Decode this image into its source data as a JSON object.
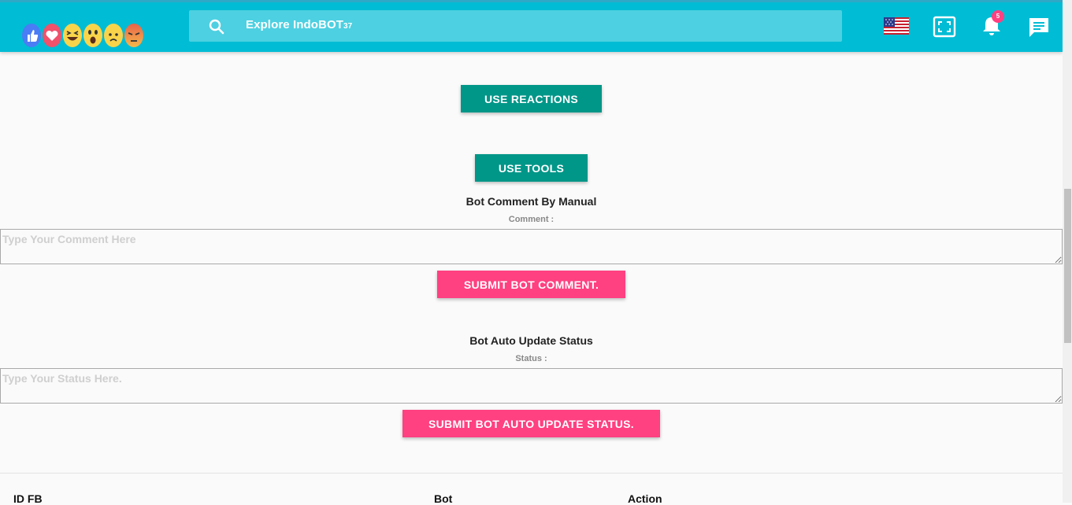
{
  "header": {
    "reaction_emojis": [
      "like-icon",
      "love-icon",
      "haha-icon",
      "wow-icon",
      "sad-icon",
      "angry-icon"
    ],
    "search": {
      "label": "Explore IndoBOT",
      "label_suffix": "37"
    },
    "notifications": {
      "count": "5"
    },
    "icons": [
      "us-flag-icon",
      "fullscreen-icon",
      "bell-icon",
      "chat-icon"
    ]
  },
  "actions": {
    "use_reactions": "USE REACTIONS",
    "use_tools": "USE TOOLS"
  },
  "comment_section": {
    "title": "Bot Comment By Manual",
    "label": "Comment :",
    "placeholder": "Type Your Comment Here",
    "submit": "SUBMIT BOT COMMENT."
  },
  "status_section": {
    "title": "Bot Auto Update Status",
    "label": "Status :",
    "placeholder": "Type Your Status Here.",
    "submit": "SUBMIT BOT AUTO UPDATE STATUS."
  },
  "table": {
    "columns": [
      "ID FB",
      "Bot",
      "Action"
    ]
  },
  "colors": {
    "header": "#00bcd4",
    "search_bg": "#4dd0e1",
    "teal_button": "#009688",
    "pink_button": "#ff4081"
  }
}
